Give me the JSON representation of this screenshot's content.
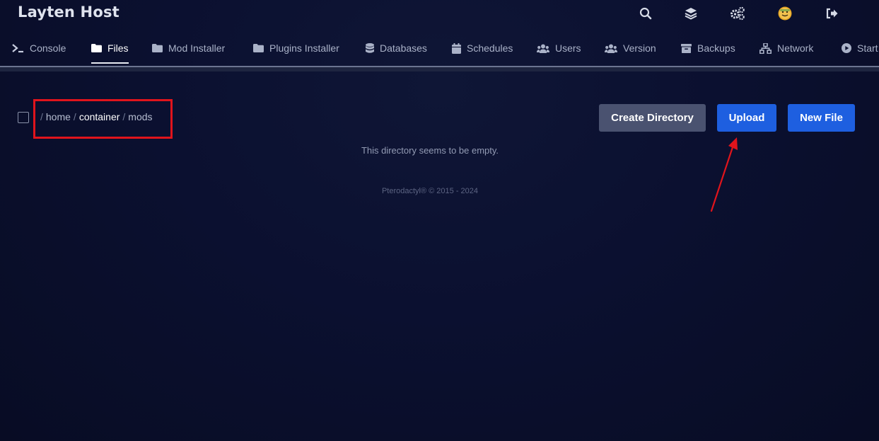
{
  "app": {
    "title": "Layten Host"
  },
  "top_icons": [
    {
      "name": "search-icon"
    },
    {
      "name": "layers-icon"
    },
    {
      "name": "cogs-icon"
    },
    {
      "name": "avatar"
    },
    {
      "name": "logout-icon"
    }
  ],
  "tabs": [
    {
      "label": "Console",
      "icon": "terminal-icon"
    },
    {
      "label": "Files",
      "icon": "folder-icon",
      "active": true
    },
    {
      "label": "Mod Installer",
      "icon": "folder-icon"
    },
    {
      "label": "Plugins Installer",
      "icon": "folder-icon"
    },
    {
      "label": "Databases",
      "icon": "database-icon"
    },
    {
      "label": "Schedules",
      "icon": "calendar-icon"
    },
    {
      "label": "Users",
      "icon": "users-icon"
    },
    {
      "label": "Version",
      "icon": "users-icon"
    },
    {
      "label": "Backups",
      "icon": "archive-icon"
    },
    {
      "label": "Network",
      "icon": "network-icon"
    },
    {
      "label": "Start",
      "icon": "play-circle-icon"
    }
  ],
  "breadcrumb": {
    "separator": "/",
    "parts": [
      "home",
      "container",
      "mods"
    ]
  },
  "actions": {
    "create_directory": "Create Directory",
    "upload": "Upload",
    "new_file": "New File"
  },
  "empty_message": "This directory seems to be empty.",
  "footer": "Pterodactyl® © 2015 - 2024",
  "colors": {
    "accent_blue": "#1e5fe0",
    "button_gray": "#4a5270",
    "annotation_red": "#e0141c",
    "background": "#0b1030"
  }
}
